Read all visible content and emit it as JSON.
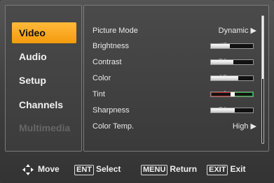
{
  "sidebar": {
    "items": [
      {
        "label": "Video",
        "state": "selected"
      },
      {
        "label": "Audio",
        "state": "normal"
      },
      {
        "label": "Setup",
        "state": "normal"
      },
      {
        "label": "Channels",
        "state": "normal"
      },
      {
        "label": "Multimedia",
        "state": "disabled"
      }
    ]
  },
  "video_settings": {
    "picture_mode": {
      "label": "Picture Mode",
      "value": "Dynamic",
      "arrow": "▶"
    },
    "brightness": {
      "label": "Brightness",
      "value": "45",
      "level": 0.45
    },
    "contrast": {
      "label": "Contrast",
      "value": "53",
      "level": 0.53
    },
    "color": {
      "label": "Color",
      "value": "65",
      "level": 0.65
    },
    "tint": {
      "label": "Tint",
      "value": "0",
      "level": 0.0
    },
    "sharpness": {
      "label": "Sharpness",
      "value": "56",
      "level": 0.56
    },
    "color_temp": {
      "label": "Color Temp.",
      "value": "High",
      "arrow": "▶"
    }
  },
  "footer": {
    "move": "Move",
    "ent_key": "ENT",
    "select": "Select",
    "menu_key": "MENU",
    "return": "Return",
    "exit_key": "EXIT",
    "exit": "Exit"
  },
  "colors": {
    "accent": "#f5a623",
    "tint_red": "#c0262c",
    "tint_green": "#2faa3a"
  }
}
